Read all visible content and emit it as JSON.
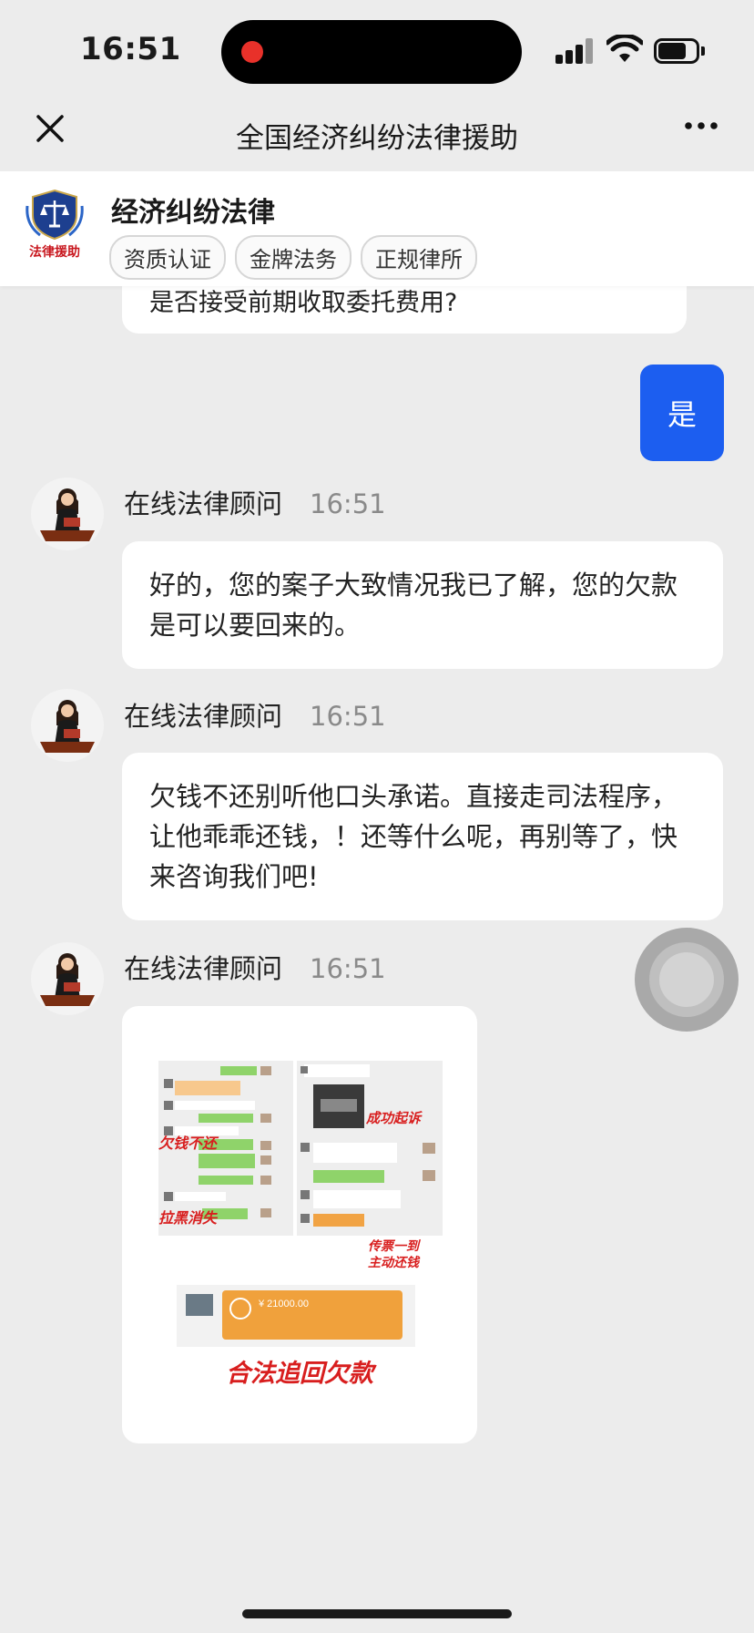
{
  "status_bar": {
    "time": "16:51"
  },
  "nav": {
    "title": "全国经济纠纷法律援助",
    "close_icon": "close-icon",
    "more_icon": "more-icon"
  },
  "profile": {
    "name": "经济纠纷法律",
    "logo_text": "法律援助",
    "tags": [
      "资质认证",
      "金牌法务",
      "正规律所"
    ]
  },
  "chat": {
    "previous_bubble_text": "是否接受前期收取委托费用?",
    "user_reply": "是",
    "messages": [
      {
        "sender": "在线法律顾问",
        "time": "16:51",
        "text": "好的，您的案子大致情况我已了解，您的欠款是可以要回来的。"
      },
      {
        "sender": "在线法律顾问",
        "time": "16:51",
        "text": "欠钱不还别听他口头承诺。直接走司法程序，让他乖乖还钱，！还等什么呢，再别等了，快来咨询我们吧!"
      },
      {
        "sender": "在线法律顾问",
        "time": "16:51",
        "type": "image"
      }
    ],
    "image_content": {
      "label_left_1": "欠钱不还",
      "label_left_2": "拉黑消失",
      "label_right_1": "成功起诉",
      "label_right_2": "传票一到",
      "label_right_3": "主动还钱",
      "payment_amount": "¥ 21000.00",
      "footer": "合法追回欠款"
    }
  },
  "colors": {
    "accent": "#1c5ef0",
    "red": "#d81e1e",
    "background": "#ececec"
  }
}
